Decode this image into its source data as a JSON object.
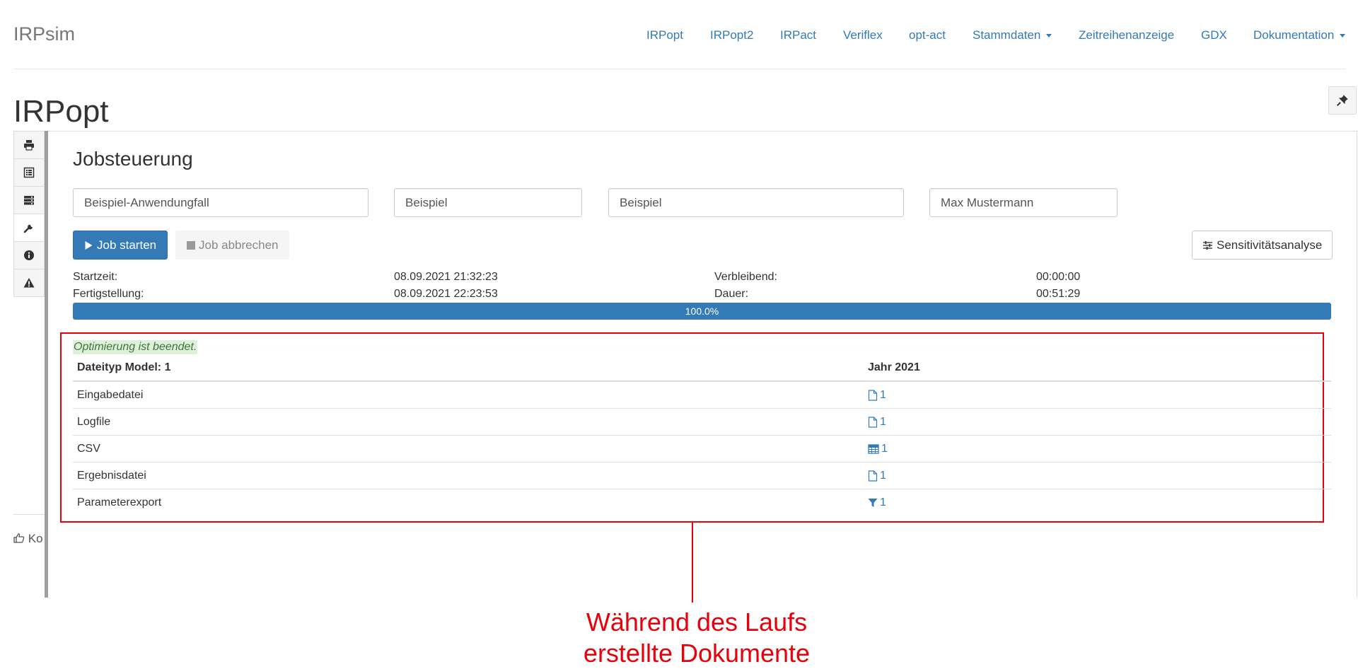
{
  "navbar": {
    "brand": "IRPsim",
    "items": [
      {
        "label": "IRPopt"
      },
      {
        "label": "IRPopt2"
      },
      {
        "label": "IRPact"
      },
      {
        "label": "Veriflex"
      },
      {
        "label": "opt-act"
      },
      {
        "label": "Stammdaten",
        "dropdown": true
      },
      {
        "label": "Zeitreihenanzeige"
      },
      {
        "label": "GDX"
      },
      {
        "label": "Dokumentation",
        "dropdown": true
      }
    ]
  },
  "page": {
    "title": "IRPopt"
  },
  "sidebar": {
    "tools": [
      {
        "icon": "print-icon"
      },
      {
        "icon": "list-icon"
      },
      {
        "icon": "server-icon"
      },
      {
        "icon": "wrench-icon",
        "active": true
      },
      {
        "icon": "info-icon"
      },
      {
        "icon": "warning-icon"
      }
    ],
    "feedback_label": "Ko"
  },
  "job": {
    "title": "Jobsteuerung",
    "fields": {
      "use_case": "Beispiel-Anwendungfall",
      "name": "Beispiel",
      "description": "Beispiel",
      "creator": "Max Mustermann"
    },
    "start_label": "Job starten",
    "abort_label": "Job abbrechen",
    "sensitivity_label": "Sensitivitätsanalyse",
    "start_time_label": "Startzeit:",
    "start_time": "08.09.2021 21:32:23",
    "end_time_label": "Fertigstellung:",
    "end_time": "08.09.2021 22:23:53",
    "remaining_label": "Verbleibend:",
    "remaining": "00:00:00",
    "duration_label": "Dauer:",
    "duration": "00:51:29",
    "progress": 100.0,
    "progress_text": "100.0%",
    "status": "Optimierung ist beendet."
  },
  "results": {
    "headers": [
      "Dateityp Model: 1",
      "Jahr 2021"
    ],
    "rows": [
      {
        "type": "Eingabedatei",
        "icon": "file-icon",
        "link": "1"
      },
      {
        "type": "Logfile",
        "icon": "file-icon",
        "link": "1"
      },
      {
        "type": "CSV",
        "icon": "table-icon",
        "link": "1"
      },
      {
        "type": "Ergebnisdatei",
        "icon": "file-icon",
        "link": "1"
      },
      {
        "type": "Parameterexport",
        "icon": "filter-icon",
        "link": "1"
      }
    ]
  },
  "annotation": {
    "line1": "Während des Laufs",
    "line2": "erstellte Dokumente",
    "color": "#e8000b"
  },
  "colors": {
    "primary": "#337ab7",
    "success_bg": "#dff0d8",
    "highlight": "#e8000b"
  }
}
